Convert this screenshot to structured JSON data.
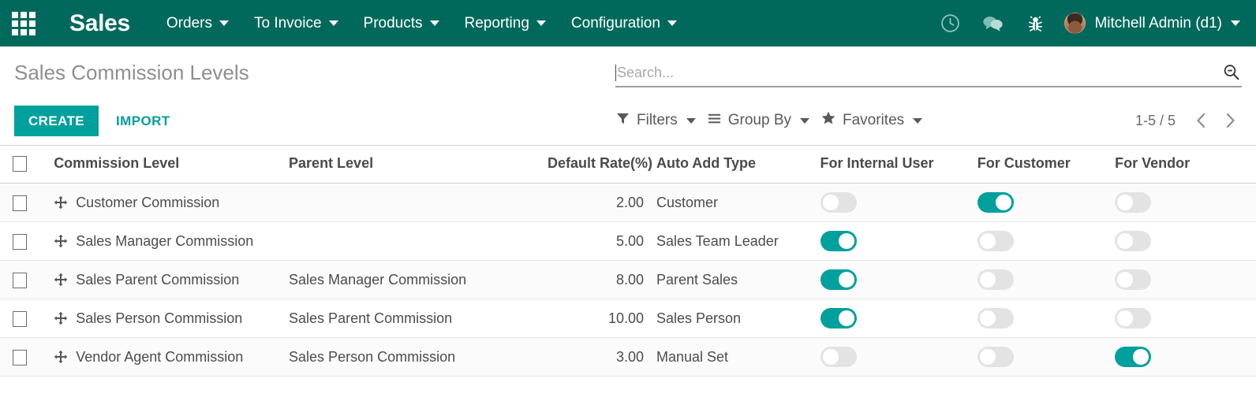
{
  "navbar": {
    "apps_icon": "apps-grid-icon",
    "brand": "Sales",
    "menus": [
      {
        "label": "Orders"
      },
      {
        "label": "To Invoice"
      },
      {
        "label": "Products"
      },
      {
        "label": "Reporting"
      },
      {
        "label": "Configuration"
      }
    ],
    "icons": [
      {
        "name": "clock-icon"
      },
      {
        "name": "messages-icon"
      },
      {
        "name": "bug-icon"
      }
    ],
    "user": "Mitchell Admin (d1)",
    "bg_color": "#00695C",
    "accent_color": "#00A09D"
  },
  "control_panel": {
    "title": "Sales Commission Levels",
    "create_label": "CREATE",
    "import_label": "IMPORT",
    "search_placeholder": "Search...",
    "search_value": "",
    "search_icon": "search-minus-icon",
    "filters_label": "Filters",
    "group_by_label": "Group By",
    "favorites_label": "Favorites",
    "pager_text": "1-5 / 5",
    "prev_icon": "chevron-left-icon",
    "next_icon": "chevron-right-icon"
  },
  "table": {
    "columns": [
      "Commission Level",
      "Parent Level",
      "Default Rate(%)",
      "Auto Add Type",
      "For Internal User",
      "For Customer",
      "For Vendor"
    ],
    "rows": [
      {
        "name": "Customer Commission",
        "parent": "",
        "rate": "2.00",
        "auto_add_type": "Customer",
        "for_internal_user": false,
        "for_customer": true,
        "for_vendor": false
      },
      {
        "name": "Sales Manager Commission",
        "parent": "",
        "rate": "5.00",
        "auto_add_type": "Sales Team Leader",
        "for_internal_user": true,
        "for_customer": false,
        "for_vendor": false
      },
      {
        "name": "Sales Parent Commission",
        "parent": "Sales Manager Commission",
        "rate": "8.00",
        "auto_add_type": "Parent Sales",
        "for_internal_user": true,
        "for_customer": false,
        "for_vendor": false
      },
      {
        "name": "Sales Person Commission",
        "parent": "Sales Parent Commission",
        "rate": "10.00",
        "auto_add_type": "Sales Person",
        "for_internal_user": true,
        "for_customer": false,
        "for_vendor": false
      },
      {
        "name": "Vendor Agent Commission",
        "parent": "Sales Person Commission",
        "rate": "3.00",
        "auto_add_type": "Manual Set",
        "for_internal_user": false,
        "for_customer": false,
        "for_vendor": true
      }
    ]
  }
}
